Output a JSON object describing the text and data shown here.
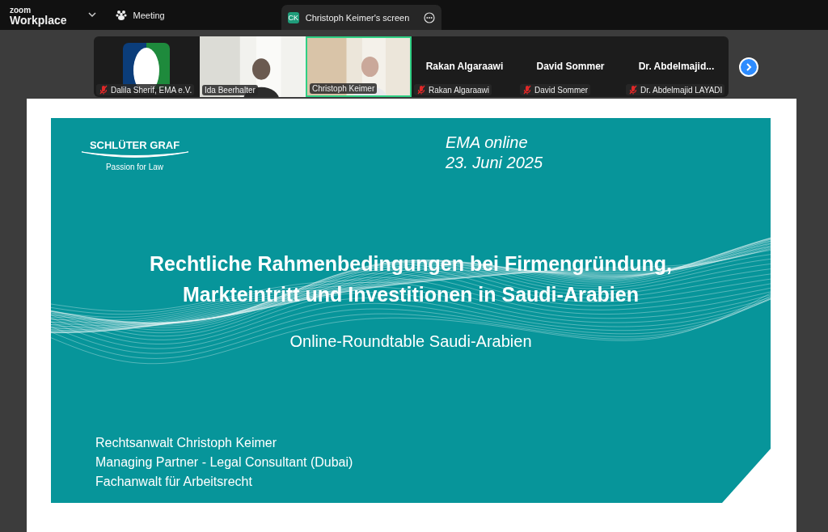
{
  "app": {
    "brand": "zoom",
    "product": "Workplace"
  },
  "menu": {
    "label": "Meeting"
  },
  "share_tab": {
    "initials": "CK",
    "title": "Christoph Keimer's screen"
  },
  "participants": [
    {
      "kind": "logo",
      "name": "Dalila Sherif, EMA e.V.",
      "muted": true,
      "speaking": false
    },
    {
      "kind": "video",
      "name": "Ida Beerhalter",
      "muted": false,
      "speaking": false
    },
    {
      "kind": "video",
      "name": "Christoph Keimer",
      "muted": false,
      "speaking": true
    },
    {
      "kind": "name",
      "display_name": "Rakan Algaraawi",
      "name": "Rakan Algaraawi",
      "muted": true,
      "speaking": false
    },
    {
      "kind": "name",
      "display_name": "David Sommer",
      "name": "David Sommer",
      "muted": true,
      "speaking": false
    },
    {
      "kind": "name",
      "display_name": "Dr.  Abdelmajid...",
      "name": "Dr. Abdelmajid LAYADI",
      "muted": true,
      "speaking": false
    }
  ],
  "slide": {
    "company": "SCHLÜTER GRAF",
    "tagline": "Passion for Law",
    "event": "EMA online",
    "date": "23. Juni 2025",
    "title_lines": [
      "Rechtliche Rahmenbedingungen bei Firmengründung,",
      "Markteintritt und Investitionen in Saudi-Arabien"
    ],
    "subtitle": "Online-Roundtable Saudi-Arabien",
    "presenter_lines": [
      "Rechtsanwalt Christoph Keimer",
      "Managing Partner - Legal Consultant (Dubai)",
      "Fachanwalt für Arbeitsrecht"
    ]
  }
}
